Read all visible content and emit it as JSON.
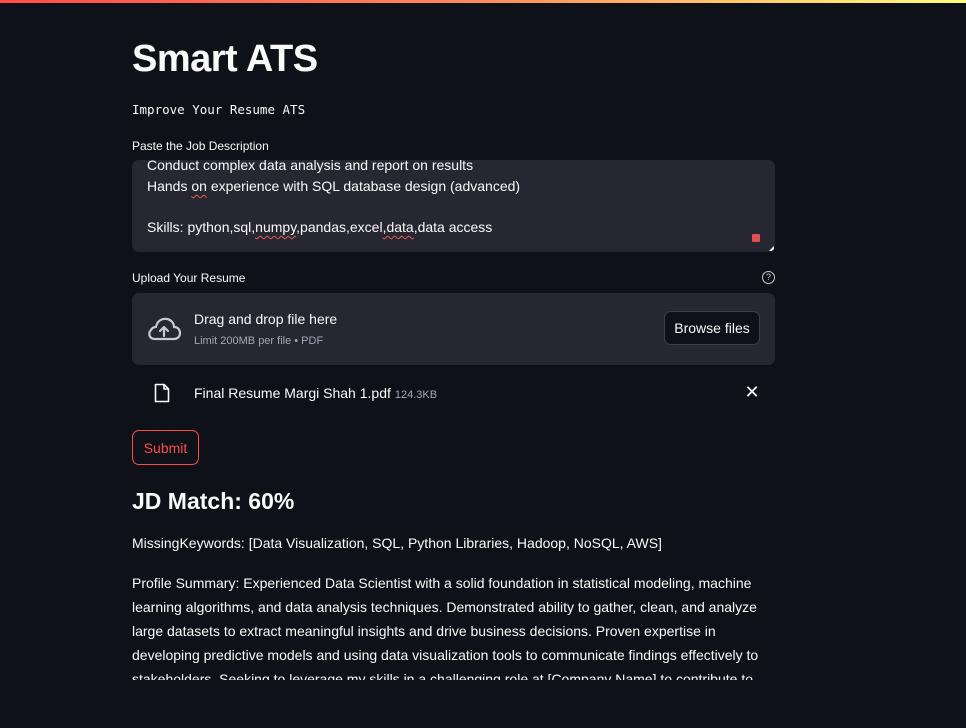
{
  "app": {
    "title": "Smart ATS",
    "subtitle": "Improve Your Resume ATS"
  },
  "job_description": {
    "label": "Paste the Job Description",
    "lines": [
      "Conduct complex data analysis and report on results",
      "Hands on experience with SQL database design (advanced)",
      "",
      "Skills: python,sql,numpy,pandas,excel,data,data access"
    ]
  },
  "upload": {
    "label": "Upload Your Resume",
    "help": "?",
    "drag_text": "Drag and drop file here",
    "limit_text": "Limit 200MB per file • PDF",
    "browse_label": "Browse files",
    "file_name": "Final Resume Margi Shah 1.pdf",
    "file_size": "124.3KB",
    "remove": "✕"
  },
  "submit_label": "Submit",
  "result": {
    "match": "JD Match: 60%",
    "missing_keywords": "MissingKeywords: [Data Visualization, SQL, Python Libraries, Hadoop, NoSQL, AWS]",
    "profile_summary": "Profile Summary: Experienced Data Scientist with a solid foundation in statistical modeling, machine learning algorithms, and data analysis techniques. Demonstrated ability to gather, clean, and analyze large datasets to extract meaningful insights and drive business decisions. Proven expertise in developing predictive models and using data visualization tools to communicate findings effectively to stakeholders. Seeking to leverage my skills in a challenging role at [Company Name] to contribute to the company's"
  },
  "colors": {
    "background": "#0e1117",
    "input_bg": "#262730",
    "accent": "#ff4b4b",
    "muted_text": "#a3a8b8"
  }
}
